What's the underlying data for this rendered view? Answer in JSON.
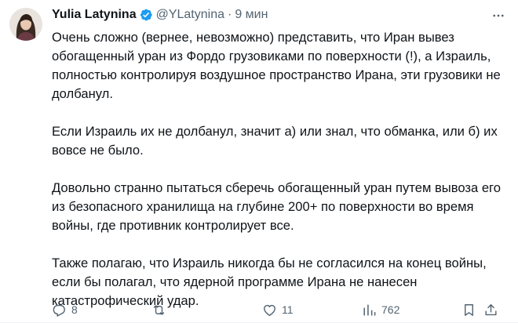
{
  "author": {
    "display_name": "Yulia Latynina",
    "handle": "@YLatynina",
    "separator": "·",
    "time": "9 мин"
  },
  "icons": {
    "avatar": "avatar-photo",
    "verified": "verified-badge-icon",
    "more": "more-icon",
    "reply": "reply-icon",
    "retweet": "retweet-icon",
    "like": "like-icon",
    "views": "views-icon",
    "bookmark": "bookmark-icon",
    "share": "share-icon"
  },
  "colors": {
    "accent": "#1d9bf0",
    "text": "#0f1419",
    "muted": "#536471"
  },
  "tweet": {
    "paragraphs": [
      "Очень сложно (вернее, невозможно) представить, что Иран вывез обогащенный уран из Фордо грузовиками по поверхности (!), а Израиль, полностью контролируя воздушное пространство Ирана, эти грузовики не долбанул.",
      "Если Израиль их не долбанул, значит а) или знал, что обманка, или б) их вовсе не было.",
      "Довольно странно пытаться сберечь обогащенный уран путем вывоза его из безопасного хранилища на глубине 200+ по поверхности во время войны, где противник контролирует все.",
      "Также полагаю, что Израиль никогда бы не согласился на конец войны, если бы полагал, что ядерной программе Ирана не нанесен катастрофический удар."
    ]
  },
  "metrics": {
    "replies": "8",
    "retweets": "",
    "likes": "11",
    "views": "762"
  }
}
